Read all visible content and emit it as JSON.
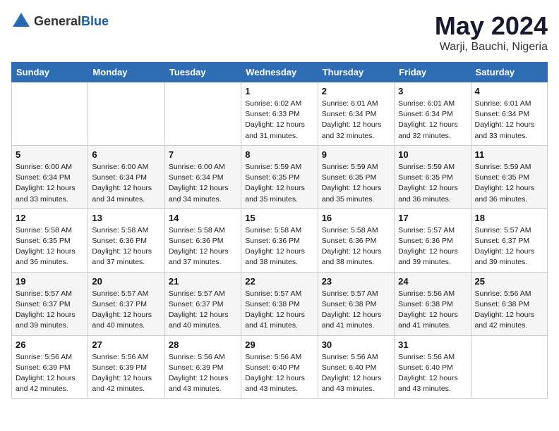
{
  "header": {
    "logo": {
      "general": "General",
      "blue": "Blue"
    },
    "title": "May 2024",
    "location": "Warji, Bauchi, Nigeria"
  },
  "calendar": {
    "days_of_week": [
      "Sunday",
      "Monday",
      "Tuesday",
      "Wednesday",
      "Thursday",
      "Friday",
      "Saturday"
    ],
    "weeks": [
      [
        {
          "day": "",
          "info": ""
        },
        {
          "day": "",
          "info": ""
        },
        {
          "day": "",
          "info": ""
        },
        {
          "day": "1",
          "info": "Sunrise: 6:02 AM\nSunset: 6:33 PM\nDaylight: 12 hours\nand 31 minutes."
        },
        {
          "day": "2",
          "info": "Sunrise: 6:01 AM\nSunset: 6:34 PM\nDaylight: 12 hours\nand 32 minutes."
        },
        {
          "day": "3",
          "info": "Sunrise: 6:01 AM\nSunset: 6:34 PM\nDaylight: 12 hours\nand 32 minutes."
        },
        {
          "day": "4",
          "info": "Sunrise: 6:01 AM\nSunset: 6:34 PM\nDaylight: 12 hours\nand 33 minutes."
        }
      ],
      [
        {
          "day": "5",
          "info": "Sunrise: 6:00 AM\nSunset: 6:34 PM\nDaylight: 12 hours\nand 33 minutes."
        },
        {
          "day": "6",
          "info": "Sunrise: 6:00 AM\nSunset: 6:34 PM\nDaylight: 12 hours\nand 34 minutes."
        },
        {
          "day": "7",
          "info": "Sunrise: 6:00 AM\nSunset: 6:34 PM\nDaylight: 12 hours\nand 34 minutes."
        },
        {
          "day": "8",
          "info": "Sunrise: 5:59 AM\nSunset: 6:35 PM\nDaylight: 12 hours\nand 35 minutes."
        },
        {
          "day": "9",
          "info": "Sunrise: 5:59 AM\nSunset: 6:35 PM\nDaylight: 12 hours\nand 35 minutes."
        },
        {
          "day": "10",
          "info": "Sunrise: 5:59 AM\nSunset: 6:35 PM\nDaylight: 12 hours\nand 36 minutes."
        },
        {
          "day": "11",
          "info": "Sunrise: 5:59 AM\nSunset: 6:35 PM\nDaylight: 12 hours\nand 36 minutes."
        }
      ],
      [
        {
          "day": "12",
          "info": "Sunrise: 5:58 AM\nSunset: 6:35 PM\nDaylight: 12 hours\nand 36 minutes."
        },
        {
          "day": "13",
          "info": "Sunrise: 5:58 AM\nSunset: 6:36 PM\nDaylight: 12 hours\nand 37 minutes."
        },
        {
          "day": "14",
          "info": "Sunrise: 5:58 AM\nSunset: 6:36 PM\nDaylight: 12 hours\nand 37 minutes."
        },
        {
          "day": "15",
          "info": "Sunrise: 5:58 AM\nSunset: 6:36 PM\nDaylight: 12 hours\nand 38 minutes."
        },
        {
          "day": "16",
          "info": "Sunrise: 5:58 AM\nSunset: 6:36 PM\nDaylight: 12 hours\nand 38 minutes."
        },
        {
          "day": "17",
          "info": "Sunrise: 5:57 AM\nSunset: 6:36 PM\nDaylight: 12 hours\nand 39 minutes."
        },
        {
          "day": "18",
          "info": "Sunrise: 5:57 AM\nSunset: 6:37 PM\nDaylight: 12 hours\nand 39 minutes."
        }
      ],
      [
        {
          "day": "19",
          "info": "Sunrise: 5:57 AM\nSunset: 6:37 PM\nDaylight: 12 hours\nand 39 minutes."
        },
        {
          "day": "20",
          "info": "Sunrise: 5:57 AM\nSunset: 6:37 PM\nDaylight: 12 hours\nand 40 minutes."
        },
        {
          "day": "21",
          "info": "Sunrise: 5:57 AM\nSunset: 6:37 PM\nDaylight: 12 hours\nand 40 minutes."
        },
        {
          "day": "22",
          "info": "Sunrise: 5:57 AM\nSunset: 6:38 PM\nDaylight: 12 hours\nand 41 minutes."
        },
        {
          "day": "23",
          "info": "Sunrise: 5:57 AM\nSunset: 6:38 PM\nDaylight: 12 hours\nand 41 minutes."
        },
        {
          "day": "24",
          "info": "Sunrise: 5:56 AM\nSunset: 6:38 PM\nDaylight: 12 hours\nand 41 minutes."
        },
        {
          "day": "25",
          "info": "Sunrise: 5:56 AM\nSunset: 6:38 PM\nDaylight: 12 hours\nand 42 minutes."
        }
      ],
      [
        {
          "day": "26",
          "info": "Sunrise: 5:56 AM\nSunset: 6:39 PM\nDaylight: 12 hours\nand 42 minutes."
        },
        {
          "day": "27",
          "info": "Sunrise: 5:56 AM\nSunset: 6:39 PM\nDaylight: 12 hours\nand 42 minutes."
        },
        {
          "day": "28",
          "info": "Sunrise: 5:56 AM\nSunset: 6:39 PM\nDaylight: 12 hours\nand 43 minutes."
        },
        {
          "day": "29",
          "info": "Sunrise: 5:56 AM\nSunset: 6:40 PM\nDaylight: 12 hours\nand 43 minutes."
        },
        {
          "day": "30",
          "info": "Sunrise: 5:56 AM\nSunset: 6:40 PM\nDaylight: 12 hours\nand 43 minutes."
        },
        {
          "day": "31",
          "info": "Sunrise: 5:56 AM\nSunset: 6:40 PM\nDaylight: 12 hours\nand 43 minutes."
        },
        {
          "day": "",
          "info": ""
        }
      ]
    ]
  }
}
